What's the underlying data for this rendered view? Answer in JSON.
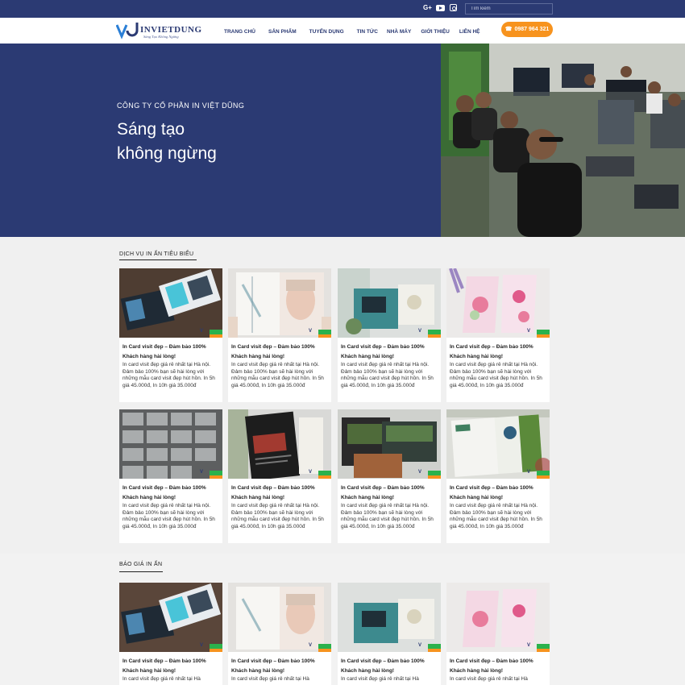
{
  "topbar": {
    "social": {
      "google": "G+",
      "youtube": "youtube-icon",
      "instagram": "instagram-icon"
    },
    "search_placeholder": "Tìm kiếm"
  },
  "header": {
    "logo_text": "INVIETDUNG",
    "logo_slogan": "Sáng Tạo Không Ngừng",
    "nav": [
      "TRANG CHỦ",
      "SẢN PHẨM",
      "TUYỂN DỤNG",
      "TIN TỨC",
      "NHÀ MÁY",
      "GIỚI THIỆU",
      "LIÊN HỆ"
    ],
    "phone": "0987 964 321"
  },
  "hero": {
    "subtitle": "CÔNG TY CỔ PHẦN IN VIỆT DŨNG",
    "title_line1": "Sáng tạo",
    "title_line2": "không ngừng"
  },
  "sections": {
    "featured_title": "DỊCH VỤ IN ẤN TIÊU BIỂU",
    "pricing_title": "BÁO GIÁ IN ẤN"
  },
  "card": {
    "title": "In Card visit đẹp – Đảm bảo 100% Khách hàng hài lòng!",
    "desc": "In card visit đẹp giá rẻ nhất tại Hà nội. Đảm bảo 100% bạn sẽ hài lòng với những mẫu card visit đẹp hút hồn. In 5h giá 45.000đ, In 10h giá 35.000đ",
    "desc_short": "In card visit đẹp giá rẻ nhất tại Hà"
  },
  "colors": {
    "primary": "#2b3a73",
    "accent": "#f7931e",
    "badge_green": "#2bb24c"
  }
}
